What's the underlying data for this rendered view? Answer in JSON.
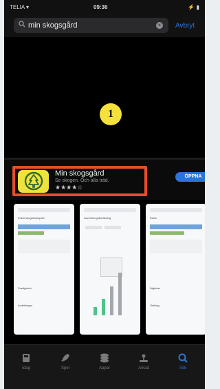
{
  "status": {
    "carrier": "TELIA ▾",
    "time": "09:36",
    "right": "⚡ ▮"
  },
  "search": {
    "query": "min skogsgård",
    "cancel_label": "Avbryt"
  },
  "badge": {
    "number": "1"
  },
  "app": {
    "name": "Min skogsgård",
    "subtitle": "Se skogen. Och alla träd.",
    "stars": "★★★★☆",
    "open_label": "ÖPPNA"
  },
  "screenshots": [
    {
      "lines": [
        "Enkel skogsbruksplan",
        "Fastigheter",
        "Avdelningar"
      ]
    },
    {
      "lines": [
        "Avverkningsberäkning",
        "Virkesvolym",
        "Kostnader"
      ]
    },
    {
      "lines": [
        "Karta",
        "Åtgärder",
        "Gallring"
      ]
    }
  ],
  "tabs": [
    {
      "label": "Idag",
      "icon": "today-icon"
    },
    {
      "label": "Spel",
      "icon": "rocket-icon"
    },
    {
      "label": "Appar",
      "icon": "layers-icon"
    },
    {
      "label": "Arkad",
      "icon": "joystick-icon"
    },
    {
      "label": "Sök",
      "icon": "search-icon"
    }
  ],
  "colors": {
    "accent": "#2f73d8",
    "highlight": "#e54d2e",
    "app_icon": "#f0e23e",
    "badge": "#f5e13b"
  }
}
